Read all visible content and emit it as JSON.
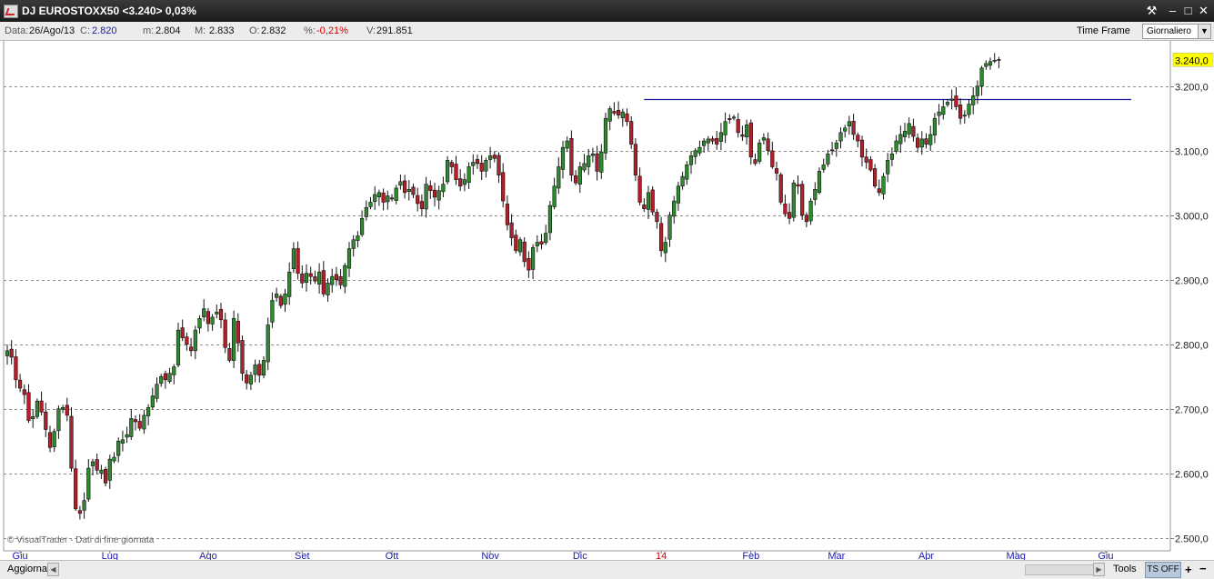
{
  "window": {
    "title": "DJ EUROSTOXX50 <3.240> 0,03%",
    "controls": {
      "settings": "⚒",
      "minimize": "–",
      "maximize": "□",
      "close": "✕"
    }
  },
  "infobar": {
    "data_label": "Data:",
    "data_value": "26/Ago/13",
    "close_label": "C:",
    "close_value": "2.820",
    "min_label": "m:",
    "min_value": "2.804",
    "max_label": "M:",
    "max_value": "2.833",
    "open_label": "O:",
    "open_value": "2.832",
    "pct_label": "%:",
    "pct_value": "-0,21%",
    "vol_label": "V:",
    "vol_value": "291.851",
    "timeframe_label": "Time Frame",
    "timeframe_value": "Giornaliero"
  },
  "colors": {
    "up": "#2f8a2f",
    "down": "#b21f2a",
    "hline": "#1a1a9a",
    "last_price_bg": "#ffff00",
    "month_label": "#1a1aa8",
    "year_label": "#d00000"
  },
  "chart_data": {
    "type": "candlestick",
    "symbol": "DJ EUROSTOXX50",
    "last_price_label": "3.240,0",
    "ylim": [
      2480,
      3270
    ],
    "yticks": [
      2500,
      2600,
      2700,
      2800,
      2900,
      3000,
      3100,
      3200
    ],
    "ytick_labels": [
      "2.500,0",
      "2.600,0",
      "2.700,0",
      "2.800,0",
      "2.900,0",
      "3.000,0",
      "3.100,0",
      "3.200,0"
    ],
    "x_labels": [
      {
        "label": "Giu",
        "index": 3
      },
      {
        "label": "Lug",
        "index": 24
      },
      {
        "label": "Ago",
        "index": 47
      },
      {
        "label": "Set",
        "index": 69
      },
      {
        "label": "Ott",
        "index": 90
      },
      {
        "label": "Nov",
        "index": 113
      },
      {
        "label": "Dic",
        "index": 134
      },
      {
        "label": "14",
        "index": 153,
        "year": true
      },
      {
        "label": "Feb",
        "index": 174
      },
      {
        "label": "Mar",
        "index": 194
      },
      {
        "label": "Apr",
        "index": 215
      },
      {
        "label": "Mag",
        "index": 236
      },
      {
        "label": "Giu",
        "index": 257
      }
    ],
    "horizontal_line": {
      "value": 3180,
      "from_index": 149,
      "to_index": 263
    },
    "watermark": "© VisualTrader - Dati di fine giornata",
    "closes": [
      2790,
      2780,
      2745,
      2732,
      2722,
      2682,
      2688,
      2712,
      2695,
      2668,
      2640,
      2665,
      2700,
      2702,
      2690,
      2608,
      2545,
      2538,
      2558,
      2608,
      2618,
      2605,
      2605,
      2585,
      2622,
      2625,
      2650,
      2652,
      2660,
      2685,
      2680,
      2670,
      2690,
      2702,
      2720,
      2738,
      2750,
      2745,
      2755,
      2765,
      2822,
      2810,
      2800,
      2790,
      2822,
      2840,
      2855,
      2832,
      2842,
      2850,
      2838,
      2795,
      2775,
      2840,
      2802,
      2755,
      2740,
      2752,
      2768,
      2752,
      2775,
      2830,
      2868,
      2878,
      2860,
      2878,
      2912,
      2948,
      2910,
      2895,
      2910,
      2905,
      2898,
      2912,
      2878,
      2895,
      2905,
      2900,
      2892,
      2922,
      2948,
      2962,
      2968,
      2995,
      3012,
      3020,
      3032,
      3035,
      3020,
      3030,
      3025,
      3042,
      3052,
      3035,
      3040,
      3032,
      3018,
      3010,
      3048,
      3038,
      3028,
      3038,
      3048,
      3085,
      3075,
      3055,
      3045,
      3055,
      3075,
      3082,
      3080,
      3068,
      3085,
      3092,
      3088,
      3062,
      3022,
      2985,
      2965,
      2945,
      2962,
      2928,
      2915,
      2950,
      2958,
      2955,
      2972,
      3015,
      3045,
      3075,
      3105,
      3115,
      3062,
      3050,
      3075,
      3080,
      3092,
      3095,
      3068,
      3098,
      3150,
      3165,
      3158,
      3155,
      3160,
      3145,
      3110,
      3062,
      3020,
      3010,
      3035,
      3005,
      2990,
      2945,
      2958,
      3000,
      3022,
      3045,
      3060,
      3078,
      3092,
      3100,
      3105,
      3115,
      3118,
      3115,
      3110,
      3128,
      3145,
      3148,
      3152,
      3128,
      3122,
      3140,
      3090,
      3080,
      3112,
      3120,
      3100,
      3075,
      3065,
      3020,
      3002,
      2995,
      3050,
      3045,
      3000,
      2990,
      3022,
      3040,
      3068,
      3078,
      3095,
      3100,
      3112,
      3128,
      3135,
      3145,
      3125,
      3115,
      3090,
      3082,
      3070,
      3045,
      3035,
      3060,
      3085,
      3095,
      3115,
      3125,
      3130,
      3142,
      3122,
      3105,
      3118,
      3110,
      3125,
      3150,
      3160,
      3168,
      3175,
      3180,
      3168,
      3150,
      3155,
      3172,
      3185,
      3200,
      3228,
      3235,
      3238,
      3240,
      3240
    ]
  }
}
